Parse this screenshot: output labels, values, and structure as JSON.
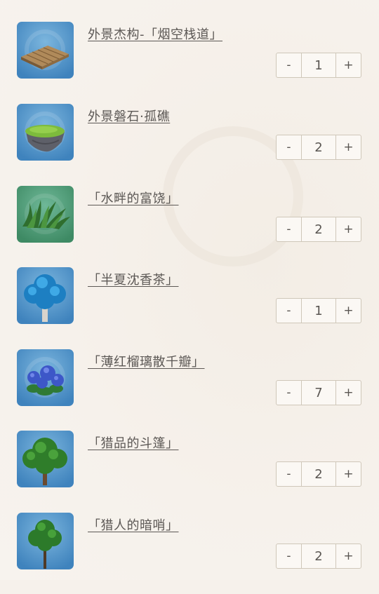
{
  "items": [
    {
      "name": "外景杰构-「烟空栈道」",
      "qty": "1",
      "minus": "-",
      "plus": "+",
      "icon": "wooden-platform-icon"
    },
    {
      "name": "外景磐石·孤礁",
      "qty": "2",
      "minus": "-",
      "plus": "+",
      "icon": "floating-rock-icon"
    },
    {
      "name": "「水畔的富饶」",
      "qty": "2",
      "minus": "-",
      "plus": "+",
      "icon": "grass-plant-icon"
    },
    {
      "name": "「半夏沈香茶」",
      "qty": "1",
      "minus": "-",
      "plus": "+",
      "icon": "blue-tree-icon"
    },
    {
      "name": "「薄红榴璃散千瓣」",
      "qty": "7",
      "minus": "-",
      "plus": "+",
      "icon": "hydrangea-flower-icon"
    },
    {
      "name": "「猎品的斗篷」",
      "qty": "2",
      "minus": "-",
      "plus": "+",
      "icon": "green-tree-icon"
    },
    {
      "name": "「猎人的暗哨」",
      "qty": "2",
      "minus": "-",
      "plus": "+",
      "icon": "thin-tree-icon"
    }
  ],
  "colors": {
    "background": "#f6f1eb",
    "text": "#5c5855",
    "stepper_border": "#cfc7b9",
    "thumb_blue": "#4a8fc4",
    "thumb_green": "#4f9c72"
  }
}
